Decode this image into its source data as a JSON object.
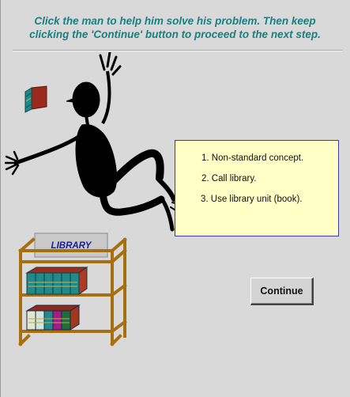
{
  "instruction": {
    "line1": "Click the man to help him solve his problem. Then keep",
    "line2": "clicking the 'Continue' button to proceed to the next step."
  },
  "steps": [
    "1. Non-standard concept.",
    "2. Call library.",
    "3. Use library unit (book)."
  ],
  "library_label": "LIBRARY",
  "continue_label": "Continue",
  "icons": {
    "floating_book": "book-icon",
    "man": "stick-man-figure",
    "shelf": "bookshelf-icon"
  },
  "colors": {
    "background": "#d9d9d9",
    "instruction_text": "#1a7f80",
    "steps_box_bg": "#ffffc6",
    "library_text": "#1c1c9a",
    "shelf_wood": "#a86f10"
  }
}
